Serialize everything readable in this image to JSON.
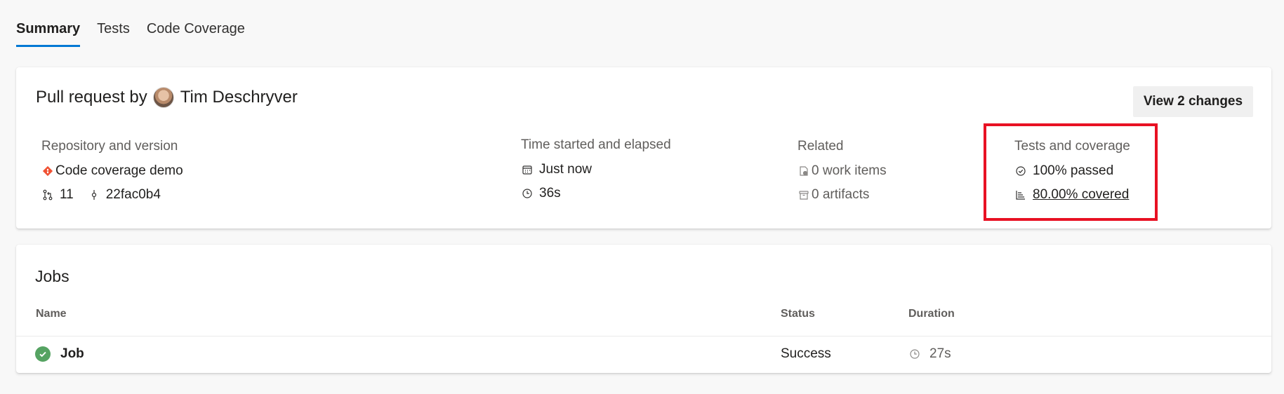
{
  "tabs": [
    {
      "label": "Summary",
      "active": true
    },
    {
      "label": "Tests",
      "active": false
    },
    {
      "label": "Code Coverage",
      "active": false
    }
  ],
  "summary": {
    "title_prefix": "Pull request by",
    "author": "Tim Deschryver",
    "view_changes_label": "View 2 changes",
    "repository": {
      "label": "Repository and version",
      "name": "Code coverage demo",
      "pr_number": "11",
      "commit": "22fac0b4"
    },
    "time": {
      "label": "Time started and elapsed",
      "started": "Just now",
      "elapsed": "36s"
    },
    "related": {
      "label": "Related",
      "work_items": "0 work items",
      "artifacts": "0 artifacts"
    },
    "tests": {
      "label": "Tests and coverage",
      "passed": "100% passed",
      "covered": "80.00% covered"
    }
  },
  "jobs": {
    "title": "Jobs",
    "columns": {
      "name": "Name",
      "status": "Status",
      "duration": "Duration"
    },
    "rows": [
      {
        "name": "Job",
        "status": "Success",
        "duration": "27s"
      }
    ]
  },
  "colors": {
    "accent": "#0078d4",
    "success": "#55a362",
    "highlight": "#e81123",
    "git": "#f05133"
  }
}
